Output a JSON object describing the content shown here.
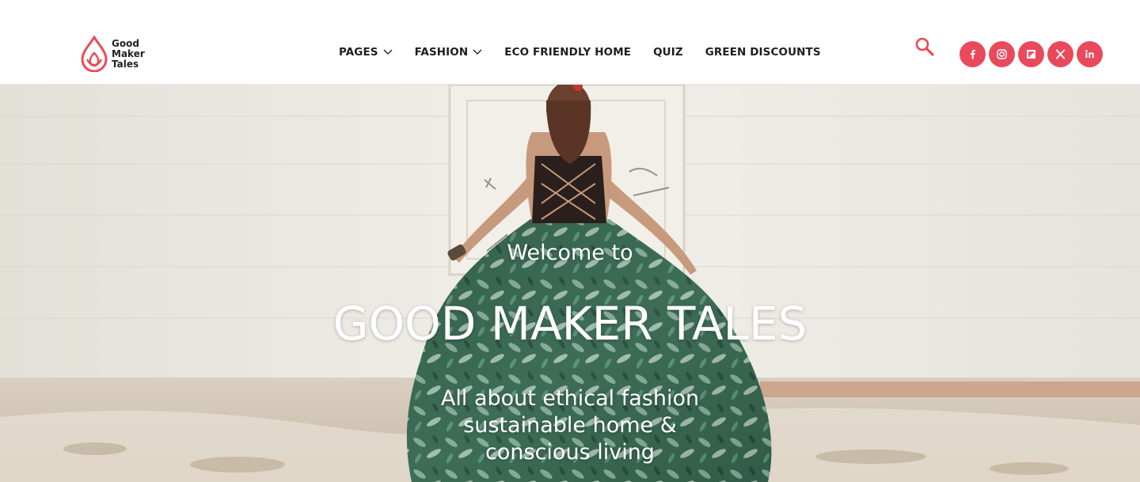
{
  "stray_text": ";",
  "brand": {
    "line1": "Good",
    "line2": "Maker",
    "line3": "Tales",
    "color": "#e94a5b"
  },
  "nav": {
    "items": [
      {
        "label": "PAGES",
        "has_dropdown": true
      },
      {
        "label": "FASHION",
        "has_dropdown": true
      },
      {
        "label": "ECO FRIENDLY HOME",
        "has_dropdown": false
      },
      {
        "label": "QUIZ",
        "has_dropdown": false
      },
      {
        "label": "GREEN DISCOUNTS",
        "has_dropdown": false
      }
    ]
  },
  "icons": {
    "search": "search-icon",
    "social": [
      "facebook-icon",
      "instagram-icon",
      "flipboard-icon",
      "x-icon",
      "linkedin-icon"
    ]
  },
  "hero": {
    "welcome": "Welcome to",
    "title": "GOOD MAKER TALES",
    "tagline_line1": "All about ethical fashion",
    "tagline_line2": "sustainable home &",
    "tagline_line3": "conscious living"
  },
  "colors": {
    "accent": "#e94a5b",
    "nav_text": "#1e1e1e",
    "hero_text": "#ffffff"
  }
}
